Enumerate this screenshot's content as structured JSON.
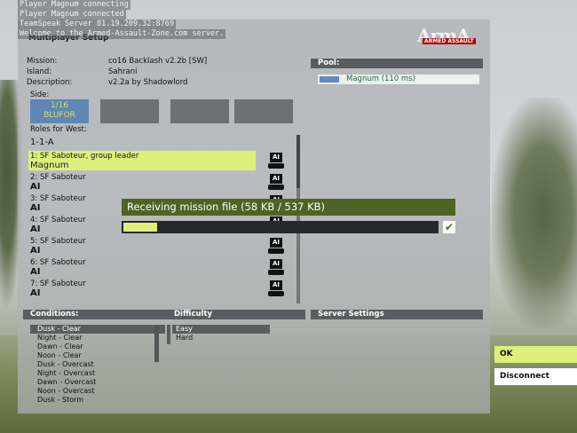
{
  "chat": [
    "Player Magnum connecting",
    "Player Magnum connected",
    "TeamSpeak Server 81.19.209.32:8769",
    "Welcome to the Armed-Assault-Zone.com server."
  ],
  "window": {
    "title": "Multiplayer Setup"
  },
  "logo": {
    "text_big": "ArmA",
    "text_small": "ARMED ASSAULT"
  },
  "mission_info": {
    "mission_label": "Mission:",
    "mission_value": "co16 Backlash v2.2b [SW]",
    "island_label": "Island:",
    "island_value": "Sahrani",
    "description_label": "Description:",
    "description_value": "v2.2a by Shadowlord"
  },
  "side": {
    "label": "Side:",
    "west_count": "1/16",
    "west_name": "BLUFOR"
  },
  "roles": {
    "label": "Roles for West:",
    "group": "1-1-A",
    "items": [
      {
        "name": "1: SF Saboteur, group leader",
        "player": "Magnum",
        "ai": "AI"
      },
      {
        "name": "2: SF Saboteur",
        "player": "AI",
        "ai": "AI"
      },
      {
        "name": "3: SF Saboteur",
        "player": "AI",
        "ai": "AI"
      },
      {
        "name": "4: SF Saboteur",
        "player": "AI",
        "ai": "AI"
      },
      {
        "name": "5: SF Saboteur",
        "player": "AI",
        "ai": "AI"
      },
      {
        "name": "6: SF Saboteur",
        "player": "AI",
        "ai": "AI"
      },
      {
        "name": "7: SF Saboteur",
        "player": "AI",
        "ai": "AI"
      }
    ]
  },
  "pool": {
    "title": "Pool:",
    "players": [
      {
        "name": "Magnum (110 ms)"
      }
    ]
  },
  "conditions": {
    "title": "Conditions:",
    "items": [
      "Dusk - Clear",
      "Night - Clear",
      "Dawn - Clear",
      "Noon - Clear",
      "Dusk - Overcast",
      "Night - Overcast",
      "Dawn - Overcast",
      "Noon - Overcast",
      "Dusk - Storm"
    ]
  },
  "difficulty": {
    "title": "Difficulty",
    "items": [
      "Easy",
      "Hard"
    ]
  },
  "server_settings": {
    "title": "Server Settings"
  },
  "download": {
    "text": "Receiving mission file (58 KB / 537 KB)",
    "progress": 0.108
  },
  "buttons": {
    "ok": "OK",
    "disconnect": "Disconnect"
  }
}
